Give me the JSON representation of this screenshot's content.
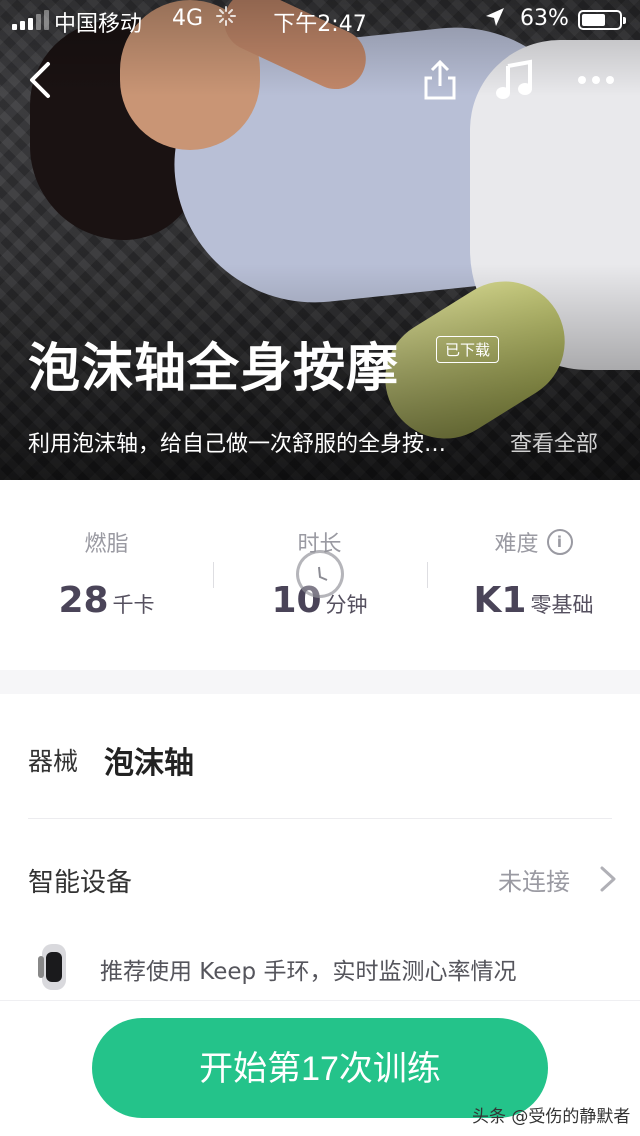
{
  "status_bar": {
    "carrier": "中国移动",
    "network": "4G",
    "time": "下午2:47",
    "battery_percent": "63%",
    "battery_level": 0.63
  },
  "hero": {
    "title": "泡沫轴全身按摩",
    "tag": "已下载",
    "description": "利用泡沫轴，给自己做一次舒服的全身按…",
    "see_all": "查看全部"
  },
  "stats": [
    {
      "label": "燃脂",
      "value": "28",
      "unit": "千卡"
    },
    {
      "label": "时长",
      "value": "10",
      "unit": "分钟"
    },
    {
      "label": "难度",
      "value": "K1",
      "unit": "零基础"
    }
  ],
  "equipment": {
    "label": "器械",
    "value": "泡沫轴"
  },
  "smart_device": {
    "label": "智能设备",
    "status": "未连接",
    "recommendation": "推荐使用 Keep 手环，实时监测心率情况"
  },
  "start_button": "开始第17次训练",
  "watermark": "头条 @受伤的静默者",
  "colors": {
    "accent": "#24c38a",
    "text_muted": "#9a9aa2"
  }
}
